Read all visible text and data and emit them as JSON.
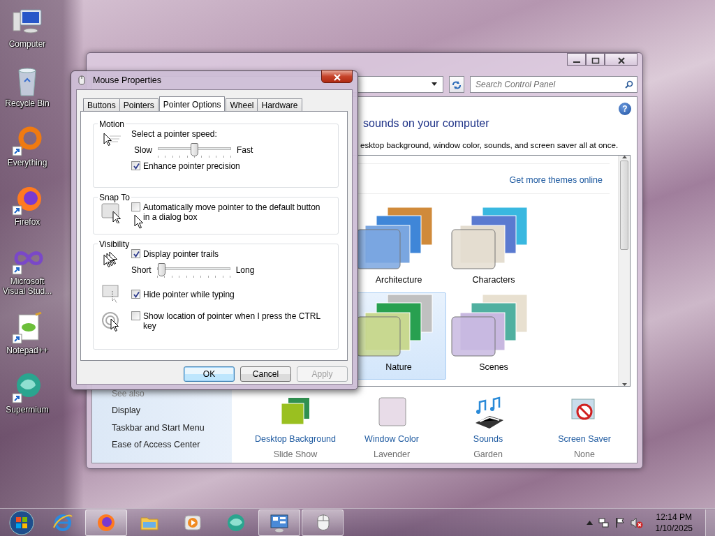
{
  "desktop_icons": [
    {
      "label": "Computer",
      "kind": "computer",
      "shortcut": false
    },
    {
      "label": "Recycle Bin",
      "kind": "recycle-bin",
      "shortcut": false
    },
    {
      "label": "Everything",
      "kind": "ring",
      "shortcut": true
    },
    {
      "label": "Firefox",
      "kind": "firefox",
      "shortcut": true
    },
    {
      "label": "Microsoft Visual Stud...",
      "kind": "infinity",
      "shortcut": true
    },
    {
      "label": "Notepad++",
      "kind": "notepad",
      "shortcut": true
    },
    {
      "label": "Supermium",
      "kind": "supermium",
      "shortcut": true
    }
  ],
  "control_panel": {
    "search": {
      "placeholder": "Search Control Panel"
    },
    "help": "?",
    "heading": "sounds on your computer",
    "description": "esktop background, window color, sounds, and screen saver all at once.",
    "themes_link": "Get more themes online",
    "themes": [
      {
        "label": "Architecture",
        "selected": false
      },
      {
        "label": "Characters",
        "selected": false
      },
      {
        "label": "Nature",
        "selected": true
      },
      {
        "label": "Scenes",
        "selected": false
      }
    ],
    "see_also": {
      "title": "See also",
      "links": [
        "Display",
        "Taskbar and Start Menu",
        "Ease of Access Center"
      ]
    },
    "settings": [
      {
        "label": "Desktop Background",
        "value": "Slide Show",
        "kind": "background"
      },
      {
        "label": "Window Color",
        "value": "Lavender",
        "kind": "color"
      },
      {
        "label": "Sounds",
        "value": "Garden",
        "kind": "sounds"
      },
      {
        "label": "Screen Saver",
        "value": "None",
        "kind": "screensaver"
      }
    ]
  },
  "dialog": {
    "title": "Mouse Properties",
    "tabs": [
      {
        "label": "Buttons",
        "selected": false
      },
      {
        "label": "Pointers",
        "selected": false
      },
      {
        "label": "Pointer Options",
        "selected": true
      },
      {
        "label": "Wheel",
        "selected": false
      },
      {
        "label": "Hardware",
        "selected": false
      }
    ],
    "motion": {
      "title": "Motion",
      "prompt": "Select a pointer speed:",
      "slider": {
        "min_label": "Slow",
        "max_label": "Fast",
        "level": 0.5
      },
      "precision": {
        "label": "Enhance pointer precision",
        "checked": true
      }
    },
    "snap_to": {
      "title": "Snap To",
      "option": {
        "label": "Automatically move pointer to the default button in a dialog box",
        "checked": false
      }
    },
    "visibility": {
      "title": "Visibility",
      "trails": {
        "label": "Display pointer trails",
        "checked": true
      },
      "trail_slider": {
        "min_label": "Short",
        "max_label": "Long",
        "level": 0.0
      },
      "hide": {
        "label": "Hide pointer while typing",
        "checked": true
      },
      "locate": {
        "label": "Show location of pointer when I press the CTRL key",
        "checked": false
      }
    },
    "buttons": [
      {
        "label": "OK",
        "default": true,
        "disabled": false
      },
      {
        "label": "Cancel",
        "default": false,
        "disabled": false
      },
      {
        "label": "Apply",
        "default": false,
        "disabled": true
      }
    ]
  },
  "taskbar": {
    "apps": [
      {
        "kind": "browser-e",
        "running": false
      },
      {
        "kind": "firefox",
        "running": true
      },
      {
        "kind": "folder",
        "running": false
      },
      {
        "kind": "media",
        "running": false
      },
      {
        "kind": "supermium",
        "running": false
      },
      {
        "kind": "control-panel",
        "running": true
      },
      {
        "kind": "mouse",
        "running": true
      }
    ],
    "clock": {
      "time": "12:14 PM",
      "date": "1/10/2025"
    }
  }
}
